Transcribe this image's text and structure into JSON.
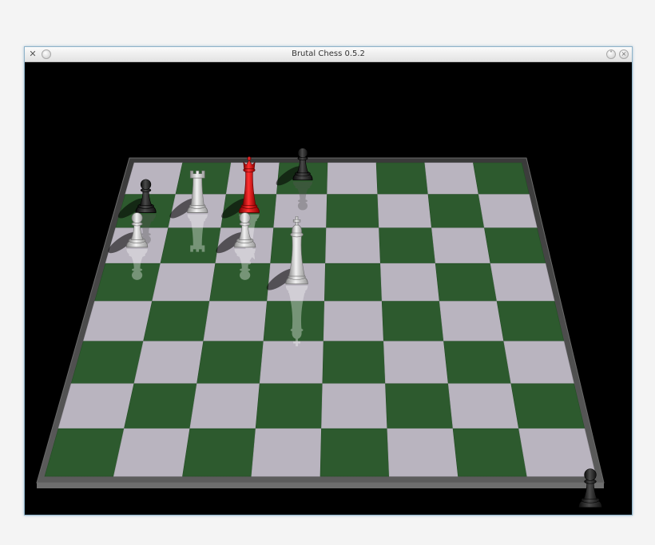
{
  "window": {
    "title": "Brutal Chess 0.5.2",
    "icons": {
      "app": "app-icon",
      "menu": "window-menu-icon",
      "minimize": "chevron-down-icon",
      "close": "close-icon"
    }
  },
  "board": {
    "files": 8,
    "ranks": 8,
    "light_square_color": "#b9b4bf",
    "dark_square_color": "#2d5a2e",
    "frame_color": "#4f4f4f",
    "background_color": "#000000"
  },
  "pieces": [
    {
      "type": "pawn",
      "color": "white",
      "file": 0,
      "rank": 5
    },
    {
      "type": "pawn",
      "color": "black",
      "file": 0,
      "rank": 6
    },
    {
      "type": "rook",
      "color": "white",
      "file": 1,
      "rank": 6
    },
    {
      "type": "queen",
      "color": "red",
      "file": 2,
      "rank": 6
    },
    {
      "type": "pawn",
      "color": "white",
      "file": 2,
      "rank": 5
    },
    {
      "type": "pawn",
      "color": "black",
      "file": 3,
      "rank": 7
    },
    {
      "type": "king",
      "color": "white",
      "file": 3,
      "rank": 4
    }
  ],
  "captured": [
    {
      "type": "pawn",
      "color": "black"
    }
  ]
}
